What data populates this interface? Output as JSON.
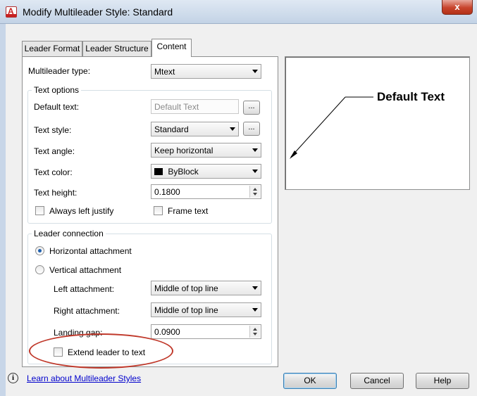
{
  "window": {
    "title": "Modify Multileader Style: Standard",
    "close_glyph": "x"
  },
  "tabs": [
    {
      "label": "Leader Format"
    },
    {
      "label": "Leader Structure"
    },
    {
      "label": "Content",
      "active": true
    }
  ],
  "content": {
    "multileader_type_label": "Multileader type:",
    "multileader_type_value": "Mtext",
    "text_options": {
      "legend": "Text options",
      "default_text_label": "Default text:",
      "default_text_value": "Default Text",
      "ellipsis_label": "...",
      "text_style_label": "Text style:",
      "text_style_value": "Standard",
      "text_angle_label": "Text angle:",
      "text_angle_value": "Keep horizontal",
      "text_color_label": "Text color:",
      "text_color_value": "ByBlock",
      "text_height_label": "Text height:",
      "text_height_value": "0.1800",
      "always_left_justify_label": "Always left justify",
      "frame_text_label": "Frame text"
    },
    "leader_connection": {
      "legend": "Leader connection",
      "horizontal_attachment_label": "Horizontal attachment",
      "vertical_attachment_label": "Vertical attachment",
      "left_attachment_label": "Left attachment:",
      "left_attachment_value": "Middle of top line",
      "right_attachment_label": "Right attachment:",
      "right_attachment_value": "Middle of top line",
      "landing_gap_label": "Landing gap:",
      "landing_gap_value": "0.0900",
      "extend_leader_label": "Extend leader to text"
    }
  },
  "preview": {
    "text": "Default Text"
  },
  "footer": {
    "info_glyph": "i",
    "help_link": "Learn about Multileader Styles",
    "ok_label": "OK",
    "cancel_label": "Cancel",
    "help_label": "Help"
  },
  "colors": {
    "highlight_oval": "#c0392b",
    "link": "#0000cc",
    "text_color_swatch": "#000000"
  }
}
